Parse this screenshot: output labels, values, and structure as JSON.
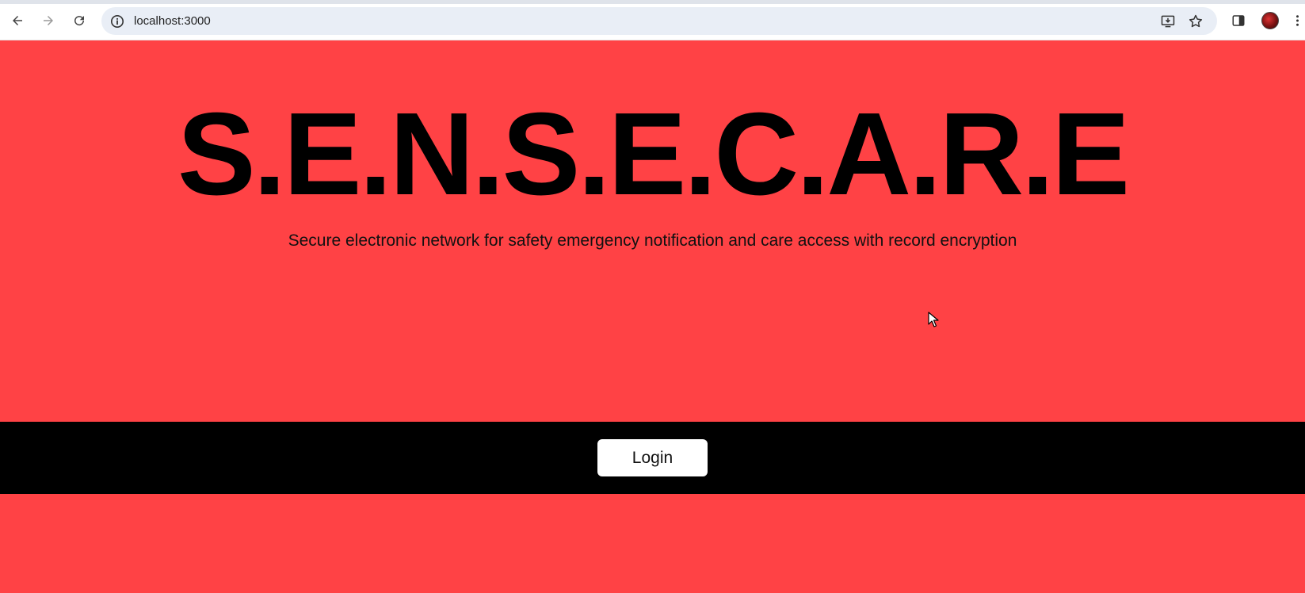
{
  "browser": {
    "url": "localhost:3000",
    "icons": [
      "back-arrow-icon",
      "forward-arrow-icon",
      "reload-icon",
      "info-icon",
      "install-app-icon",
      "star-icon",
      "side-panel-icon",
      "profile-avatar",
      "more-menu-icon"
    ]
  },
  "page": {
    "title": "S.E.N.S.E.C.A.R.E",
    "subtitle": "Secure electronic network for safety emergency notification and care access with record encryption",
    "login_label": "Login",
    "colors": {
      "background": "#ff4245",
      "bar": "#000000",
      "button": "#ffffff"
    }
  }
}
